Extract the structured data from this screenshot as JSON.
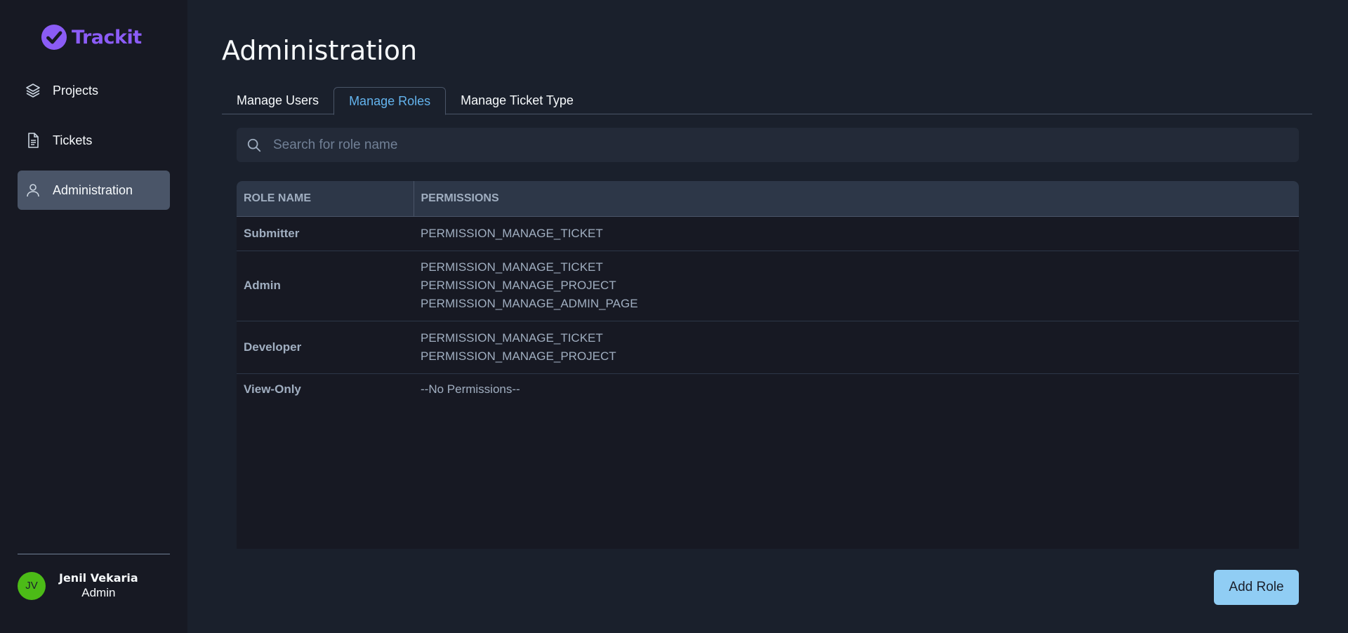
{
  "app": {
    "name": "Trackit",
    "brand_color": "#8b5cf6"
  },
  "sidebar": {
    "items": [
      {
        "label": "Projects",
        "icon": "layers-icon",
        "active": false
      },
      {
        "label": "Tickets",
        "icon": "document-icon",
        "active": false
      },
      {
        "label": "Administration",
        "icon": "user-icon",
        "active": true
      }
    ]
  },
  "user": {
    "initials": "JV",
    "name": "Jenil Vekaria",
    "role": "Admin",
    "avatar_color": "#4cbb17"
  },
  "page": {
    "title": "Administration"
  },
  "tabs": [
    {
      "label": "Manage Users",
      "active": false
    },
    {
      "label": "Manage Roles",
      "active": true
    },
    {
      "label": "Manage Ticket Type",
      "active": false
    }
  ],
  "search": {
    "placeholder": "Search for role name",
    "value": ""
  },
  "table": {
    "headers": [
      "ROLE NAME",
      "PERMISSIONS"
    ],
    "rows": [
      {
        "role": "Submitter",
        "permissions": [
          "PERMISSION_MANAGE_TICKET"
        ]
      },
      {
        "role": "Admin",
        "permissions": [
          "PERMISSION_MANAGE_TICKET",
          "PERMISSION_MANAGE_PROJECT",
          "PERMISSION_MANAGE_ADMIN_PAGE"
        ]
      },
      {
        "role": "Developer",
        "permissions": [
          "PERMISSION_MANAGE_TICKET",
          "PERMISSION_MANAGE_PROJECT"
        ]
      },
      {
        "role": "View-Only",
        "permissions": [
          "--No Permissions--"
        ]
      }
    ]
  },
  "actions": {
    "add_role_label": "Add Role",
    "accent": "#90cdf4"
  }
}
